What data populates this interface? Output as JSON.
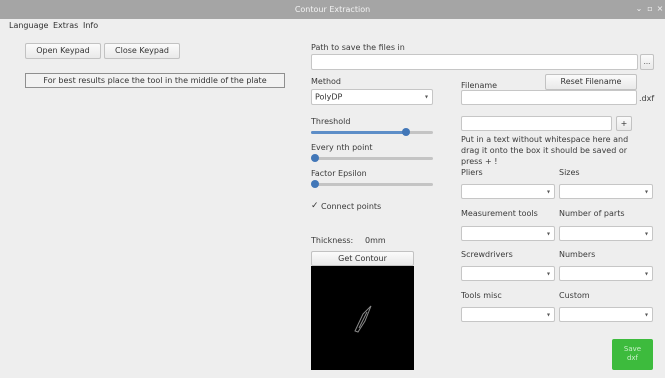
{
  "window": {
    "title": "Contour Extraction",
    "controls": [
      "⌄",
      "▫",
      "×"
    ]
  },
  "menu": {
    "items": [
      "Language",
      "Extras",
      "Info"
    ]
  },
  "left": {
    "open_keypad": "Open Keypad",
    "close_keypad": "Close Keypad",
    "hint": "For best results place the tool in the middle of the plate"
  },
  "path": {
    "label": "Path to save the files in",
    "value": "",
    "browse": "..."
  },
  "method": {
    "label": "Method",
    "value": "PolyDP"
  },
  "threshold": {
    "label": "Threshold",
    "level": 0.78
  },
  "every_nth": {
    "label": "Every nth point",
    "level": 0.0
  },
  "factor_epsilon": {
    "label": "Factor Epsilon",
    "level": 0.0
  },
  "connect_points": {
    "label": "Connect points",
    "checked": true
  },
  "thickness": {
    "label": "Thickness:",
    "value": "0mm"
  },
  "get_contour": "Get Contour",
  "filename": {
    "label": "Filename",
    "reset": "Reset Filename",
    "ext": ".dxf",
    "value": ""
  },
  "drag": {
    "value": "",
    "plus": "+",
    "help": "Put in a text without whitespace here and drag it onto the box it should be saved or press + !"
  },
  "categories": [
    {
      "label": "Pliers"
    },
    {
      "label": "Sizes"
    },
    {
      "label": "Measurement tools"
    },
    {
      "label": "Number of parts"
    },
    {
      "label": "Screwdrivers"
    },
    {
      "label": "Numbers"
    },
    {
      "label": "Tools misc"
    },
    {
      "label": "Custom"
    }
  ],
  "save_dxf": {
    "label": "Save dxf",
    "color": "#3dbb3d"
  }
}
